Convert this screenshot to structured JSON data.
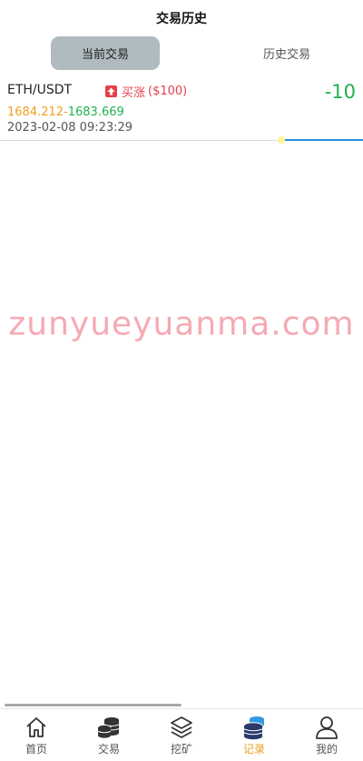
{
  "header": {
    "title": "交易历史"
  },
  "tabs": [
    {
      "label": "当前交易",
      "active": true
    },
    {
      "label": "历史交易",
      "active": false
    }
  ],
  "trade": {
    "pair": "ETH/USDT",
    "direction_label": "买涨",
    "amount": "($100)",
    "profit": "-10",
    "open_price": "1684.212",
    "separator": "-",
    "close_price": "1683.669",
    "time": "2023-02-08 09:23:29"
  },
  "watermark": "zunyueyuanma.com",
  "nav": [
    {
      "label": "首页",
      "icon": "home-icon"
    },
    {
      "label": "交易",
      "icon": "coins-icon"
    },
    {
      "label": "挖矿",
      "icon": "layers-icon"
    },
    {
      "label": "记录",
      "icon": "records-icon",
      "active": true
    },
    {
      "label": "我的",
      "icon": "user-icon"
    }
  ],
  "colors": {
    "accent": "#e6a01c",
    "up": "#e5404b",
    "profit": "#22b14c",
    "tab_active_bg": "#b0bbbf",
    "watermark": "#f6aab4"
  }
}
